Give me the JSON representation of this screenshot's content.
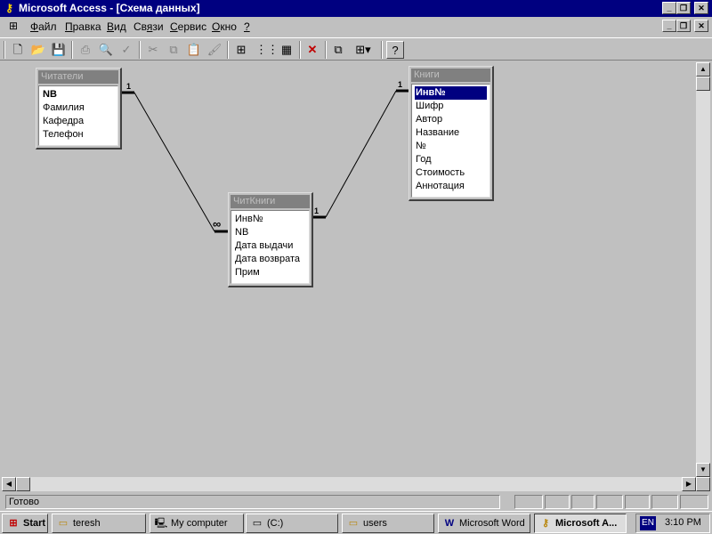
{
  "window": {
    "title": "Microsoft Access - [Схема данных]",
    "app_icon": "key-icon"
  },
  "menu": [
    {
      "label": "Файл",
      "hotkey": "Ф",
      "rest": "айл"
    },
    {
      "label": "Правка",
      "hotkey": "П",
      "rest": "равка"
    },
    {
      "label": "Вид",
      "hotkey": "В",
      "rest": "ид"
    },
    {
      "label": "Связи",
      "hotkey": "я",
      "rest": "Св|зи"
    },
    {
      "label": "Сервис",
      "hotkey": "С",
      "rest": "ервис"
    },
    {
      "label": "Окно",
      "hotkey": "О",
      "rest": "кно"
    },
    {
      "label": "?",
      "hotkey": "?",
      "rest": ""
    }
  ],
  "toolbar": {
    "buttons": [
      "new-icon",
      "open-icon",
      "save-icon",
      "print-icon",
      "print-preview-icon",
      "spelling-icon",
      "cut-icon",
      "copy-icon",
      "paste-icon",
      "format-painter-icon",
      "show-table-icon",
      "show-direct-icon",
      "show-all-icon",
      "delete-icon",
      "database-window-icon",
      "new-object-icon",
      "help-icon"
    ]
  },
  "tables": {
    "readers": {
      "name": "Читатели",
      "fields": [
        "NB",
        "Фамилия",
        "Кафедра",
        "Телефон"
      ]
    },
    "books": {
      "name": "Книги",
      "fields": [
        "Инв№",
        "Шифр",
        "Автор",
        "Название",
        "№",
        "Год",
        "Стоимость",
        "Аннотация"
      ]
    },
    "loans": {
      "name": "ЧитКниги",
      "fields": [
        "Инв№",
        "NB",
        "Дата выдачи",
        "Дата возврата",
        "Прим"
      ]
    }
  },
  "relations": {
    "one": "1",
    "many": "∞"
  },
  "status": {
    "text": "Готово"
  },
  "taskbar": {
    "start": "Start",
    "items": [
      {
        "label": "teresh",
        "icon": "folder-icon"
      },
      {
        "label": "My computer",
        "icon": "computer-icon"
      },
      {
        "label": "(C:)",
        "icon": "drive-icon"
      },
      {
        "label": "users",
        "icon": "folder-icon"
      },
      {
        "label": "Microsoft Word",
        "icon": "word-icon"
      },
      {
        "label": "Microsoft A...",
        "icon": "key-icon"
      }
    ],
    "lang": "EN",
    "clock": "3:10 PM"
  }
}
